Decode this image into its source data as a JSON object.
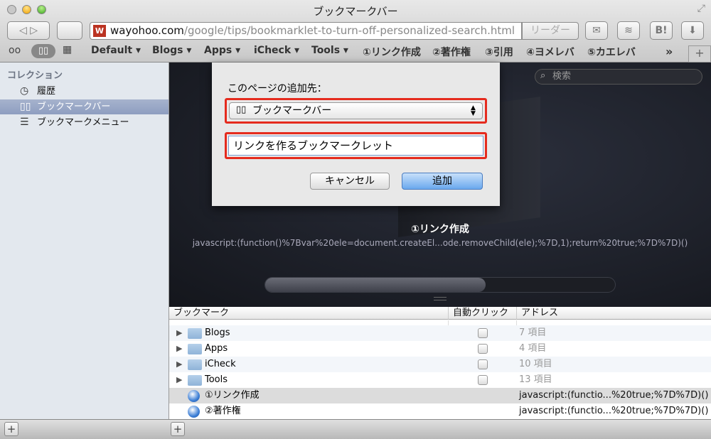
{
  "window": {
    "title": "ブックマークバー"
  },
  "toolbar": {
    "url_domain": "wayohoo.com",
    "url_path": "/google/tips/bookmarklet-to-turn-off-personalized-search.html",
    "favicon_text": "W",
    "reader_label": "リーダー",
    "hatena_label": "B!"
  },
  "bookmarks_bar": {
    "items": [
      "Default ▾",
      "Blogs ▾",
      "Apps ▾",
      "iCheck ▾",
      "Tools ▾",
      "①リンク作成",
      "②著作権",
      "③引用",
      "④ヨメレバ",
      "⑤カエレバ"
    ],
    "overflow": "»",
    "add": "+"
  },
  "sidebar": {
    "header": "コレクション",
    "items": [
      {
        "label": "履歴",
        "icon": "clock-icon"
      },
      {
        "label": "ブックマークバー",
        "icon": "book-icon",
        "selected": true
      },
      {
        "label": "ブックマークメニュー",
        "icon": "menu-list-icon"
      }
    ]
  },
  "dialog": {
    "prompt": "このページの追加先：",
    "folder_select": "ブックマークバー",
    "name_value": "リンクを作るブックマークレット",
    "cancel": "キャンセル",
    "add": "追加"
  },
  "coverflow": {
    "search_placeholder": "検索",
    "selected_title": "①リンク作成",
    "selected_url": "javascript:(function()%7Bvar%20ele=document.createEl...ode.removeChild(ele);%7D,1);return%20true;%7D%7D)()",
    "scroll_position_percent": 63
  },
  "table": {
    "headers": [
      "ブックマーク",
      "自動クリック",
      "アドレス"
    ],
    "rows": [
      {
        "name": "Blogs",
        "type": "folder",
        "address": "7 項目"
      },
      {
        "name": "Apps",
        "type": "folder",
        "address": "4 項目"
      },
      {
        "name": "iCheck",
        "type": "folder",
        "address": "10 項目"
      },
      {
        "name": "Tools",
        "type": "folder",
        "address": "13 項目"
      },
      {
        "name": "①リンク作成",
        "type": "bookmark",
        "address": "javascript:(functio...%20true;%7D%7D)()",
        "selected": true
      },
      {
        "name": "②著作権",
        "type": "bookmark",
        "address": "javascript:(functio...%20true;%7D%7D)()"
      }
    ]
  },
  "bottom": {
    "add_label": "+"
  }
}
